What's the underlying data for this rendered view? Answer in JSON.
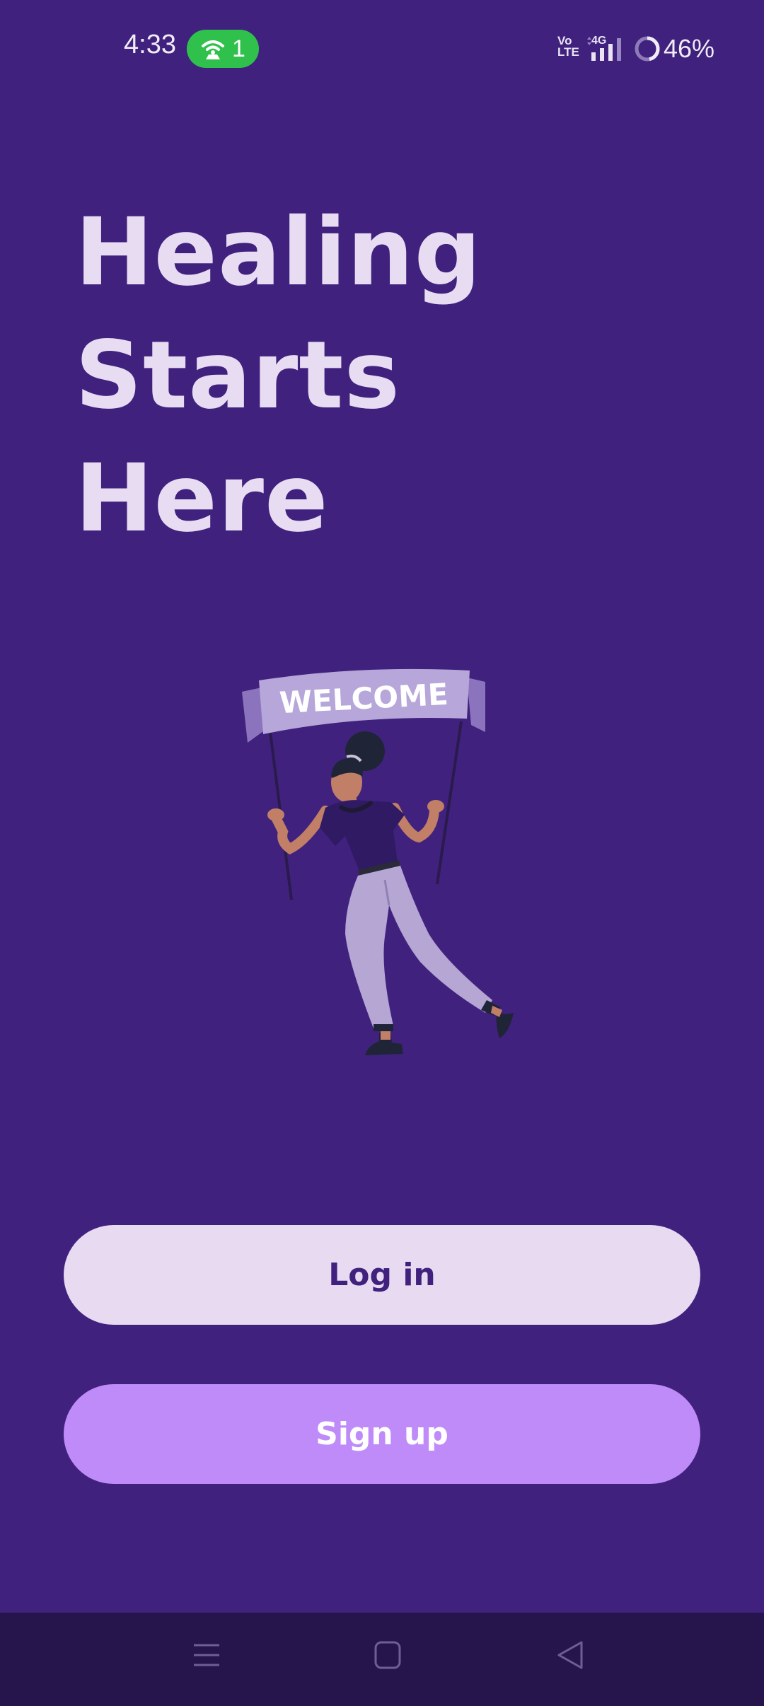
{
  "status_bar": {
    "time": "4:33",
    "hotspot_count": "1",
    "volte_line1": "Vo",
    "volte_line2": "LTE",
    "network": "4G",
    "battery": "46%",
    "battery_level": 0.46,
    "hotspot_color": "#2fc14b"
  },
  "headline": {
    "line1": "Healing",
    "line2": "Starts",
    "line3": "Here"
  },
  "illustration": {
    "banner_text": "WELCOME"
  },
  "buttons": {
    "login": "Log in",
    "signup": "Sign up"
  },
  "colors": {
    "background": "#40227e",
    "headline": "#e8dcf3",
    "login_bg": "#e7daf1",
    "signup_bg": "#bf8bf9",
    "navbar": "#25154c"
  },
  "nav_icons": [
    "menu-icon",
    "home-icon",
    "back-icon"
  ]
}
